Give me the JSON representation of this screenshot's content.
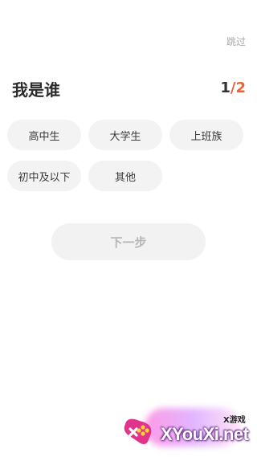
{
  "header": {
    "skip_label": "跳过"
  },
  "main": {
    "title": "我是谁",
    "pager": {
      "current": "1",
      "separator": "/",
      "total": "2"
    },
    "options": [
      {
        "label": "高中生"
      },
      {
        "label": "大学生"
      },
      {
        "label": "上班族"
      },
      {
        "label": "初中及以下"
      },
      {
        "label": "其他"
      }
    ],
    "next_label": "下一步"
  },
  "watermark": {
    "small_text": "X游戏",
    "brand_text": "XYouXi.net"
  },
  "colors": {
    "accent": "#e8643a",
    "chip_bg": "#f3f3f3",
    "next_disabled_text": "#b6b6b6"
  }
}
